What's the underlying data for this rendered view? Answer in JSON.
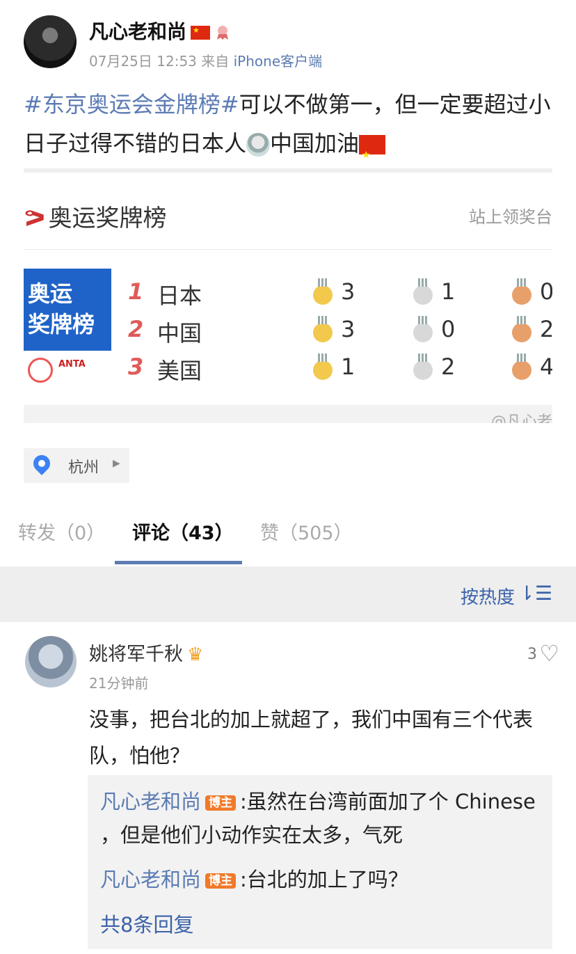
{
  "post": {
    "author": "凡心老和尚",
    "date": "07月25日 12:53",
    "source_prefix": "来自 ",
    "source": "iPhone客户端",
    "hashtag": "#东京奥运会金牌榜#",
    "text_after_tag": "可以不做第一，但一定要超过小日子过得不错的日本人",
    "text_tail": "中国加油"
  },
  "image": {
    "title": "奥运奖牌榜",
    "title_right": "站上领奖台",
    "logo_line1": "奥运",
    "logo_line2": "奖牌榜",
    "logo_brand": "ANTA",
    "watermark": "@凡心老",
    "rows": [
      {
        "rank": "1",
        "country": "日本",
        "gold": "3",
        "silver": "1",
        "bronze": "0"
      },
      {
        "rank": "2",
        "country": "中国",
        "gold": "3",
        "silver": "0",
        "bronze": "2"
      },
      {
        "rank": "3",
        "country": "美国",
        "gold": "1",
        "silver": "2",
        "bronze": "4"
      }
    ]
  },
  "location": "杭州",
  "tabs": {
    "repost": "转发（0）",
    "comment": "评论（43）",
    "like": "赞（505）"
  },
  "sort": {
    "label": "按热度",
    "icon": "sort-icon"
  },
  "comment": {
    "name": "姚将军千秋",
    "time": "21分钟前",
    "likes": "3",
    "text": "没事，把台北的加上就超了，我们中国有三个代表队，怕他？",
    "replies": [
      {
        "name": "凡心老和尚",
        "badge": "博主",
        "text": ":虽然在台湾前面加了个 Chinese ，但是他们小动作实在太多，气死"
      },
      {
        "name": "凡心老和尚",
        "badge": "博主",
        "text": ":台北的加上了吗？"
      }
    ],
    "more": "共8条回复"
  },
  "colors": {
    "link": "#5b7bb3",
    "accent": "#3b62a8",
    "badge": "#f07a2a"
  }
}
